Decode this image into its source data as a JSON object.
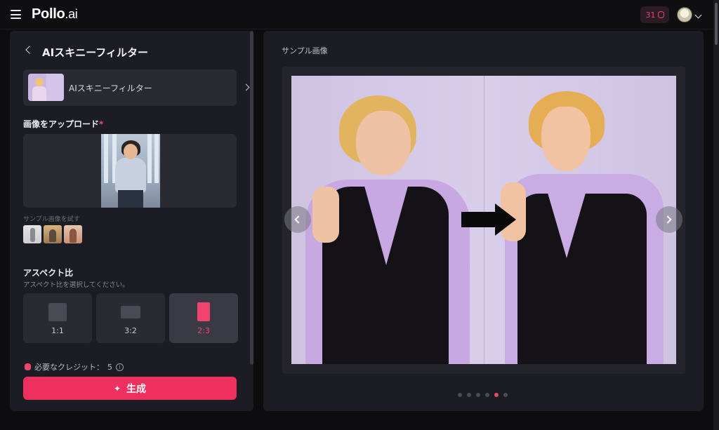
{
  "header": {
    "logo_main": "Pollo",
    "logo_suffix": ".ai",
    "credits": "31"
  },
  "left_panel": {
    "title": "AIスキニーフィルター",
    "tool_card": {
      "name": "AIスキニーフィルター"
    },
    "upload": {
      "label": "画像をアップロード",
      "required_mark": "*",
      "sample_label": "サンプル画像を試す"
    },
    "aspect": {
      "title": "アスペクト比",
      "subtitle": "アスペクト比を選択してください。",
      "options": [
        {
          "label": "1:1",
          "selected": false
        },
        {
          "label": "3:2",
          "selected": false
        },
        {
          "label": "2:3",
          "selected": true
        }
      ]
    },
    "credit_required": "必要なクレジット：",
    "credit_value": "5",
    "generate_label": "生成"
  },
  "right_panel": {
    "title": "サンプル画像",
    "carousel": {
      "total": 6,
      "active_index": 4
    }
  },
  "colors": {
    "accent": "#ef2f5e",
    "panel": "#1c1c24",
    "background": "#0d0d10"
  },
  "icons": [
    "menu-icon",
    "coin-icon",
    "chevron-left-icon",
    "chevron-right-icon",
    "chevron-down-icon",
    "info-icon",
    "sparkle-icon",
    "database-icon",
    "arrow-right-icon"
  ]
}
